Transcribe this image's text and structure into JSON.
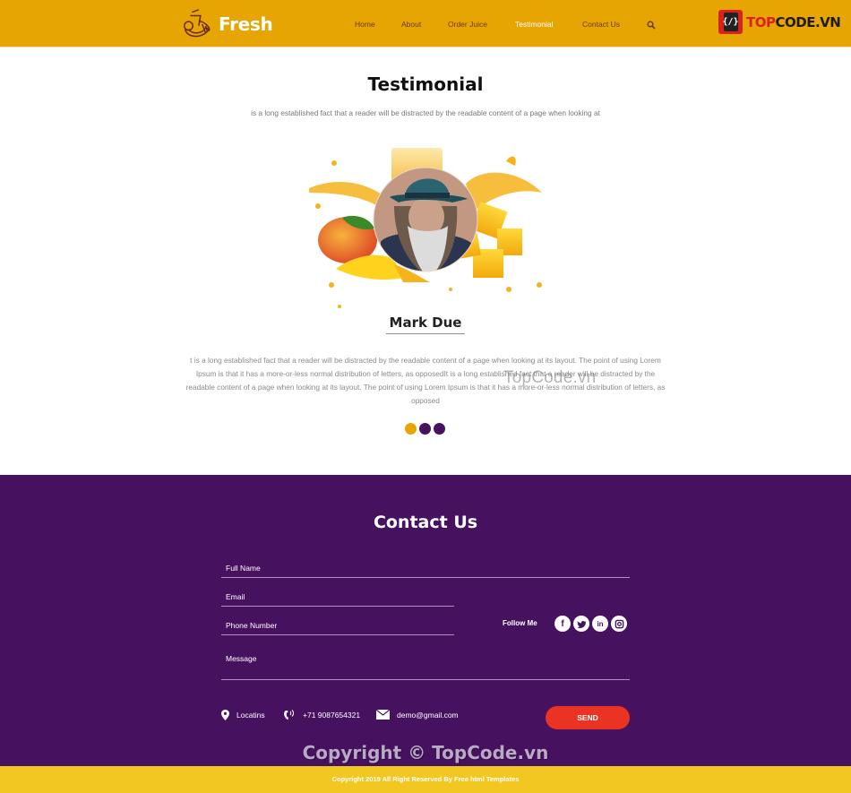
{
  "header": {
    "brand": "Fresh",
    "nav": [
      {
        "label": "Home",
        "active": false
      },
      {
        "label": "About",
        "active": false
      },
      {
        "label": "Order Juice",
        "active": false
      },
      {
        "label": "Testimonial",
        "active": true
      },
      {
        "label": "Contact Us",
        "active": false
      }
    ],
    "search_icon": "search-icon",
    "watermark_logo": {
      "badge": "{/}",
      "text_red": "TOP",
      "text_dark": "CODE.VN"
    }
  },
  "testimonial": {
    "title": "Testimonial",
    "subtitle": "is a long established fact that a reader will be distracted by the readable content of a page when looking at",
    "person_name": "Mark Due",
    "quote": "t is a long established fact that a reader will be distracted by the readable content of a page when looking at its layout. The point of using Lorem Ipsum is that it has a more-or-less normal distribution of letters, as opposedIt is a long established fact that a reader will be distracted by the readable content of a page when looking at its layout. The point of using Lorem Ipsum is that it has a more-or-less normal distribution of letters, as opposed",
    "watermark": "TopCode.vn",
    "carousel": {
      "count": 3,
      "active_index": 0
    }
  },
  "contact": {
    "title": "Contact Us",
    "fields": {
      "full_name": {
        "placeholder": "Full Name",
        "value": ""
      },
      "email": {
        "placeholder": "Email",
        "value": ""
      },
      "phone": {
        "placeholder": "Phone Number",
        "value": ""
      },
      "message": {
        "placeholder": "Message",
        "value": ""
      }
    },
    "follow_label": "Follow Me",
    "socials": [
      {
        "name": "facebook",
        "glyph": "f"
      },
      {
        "name": "twitter",
        "glyph": "t"
      },
      {
        "name": "linkedin",
        "glyph": "in"
      },
      {
        "name": "instagram",
        "glyph": "◎"
      }
    ],
    "location": "Locatins",
    "phone": "+71 9087654321",
    "email": "demo@gmail.com",
    "send_label": "SEND",
    "watermark": "Copyright © TopCode.vn"
  },
  "footer": {
    "text": "Copyright 2019 All Right Reserved By Free html Templates"
  },
  "colors": {
    "header_bg": "#e6a503",
    "contact_bg": "#461260",
    "send_button": "#ea3323",
    "footer_bg": "#f3c721",
    "nav_text": "#6b3a1a",
    "dot_active": "#e6a503",
    "dot_inactive": "#48125f"
  }
}
